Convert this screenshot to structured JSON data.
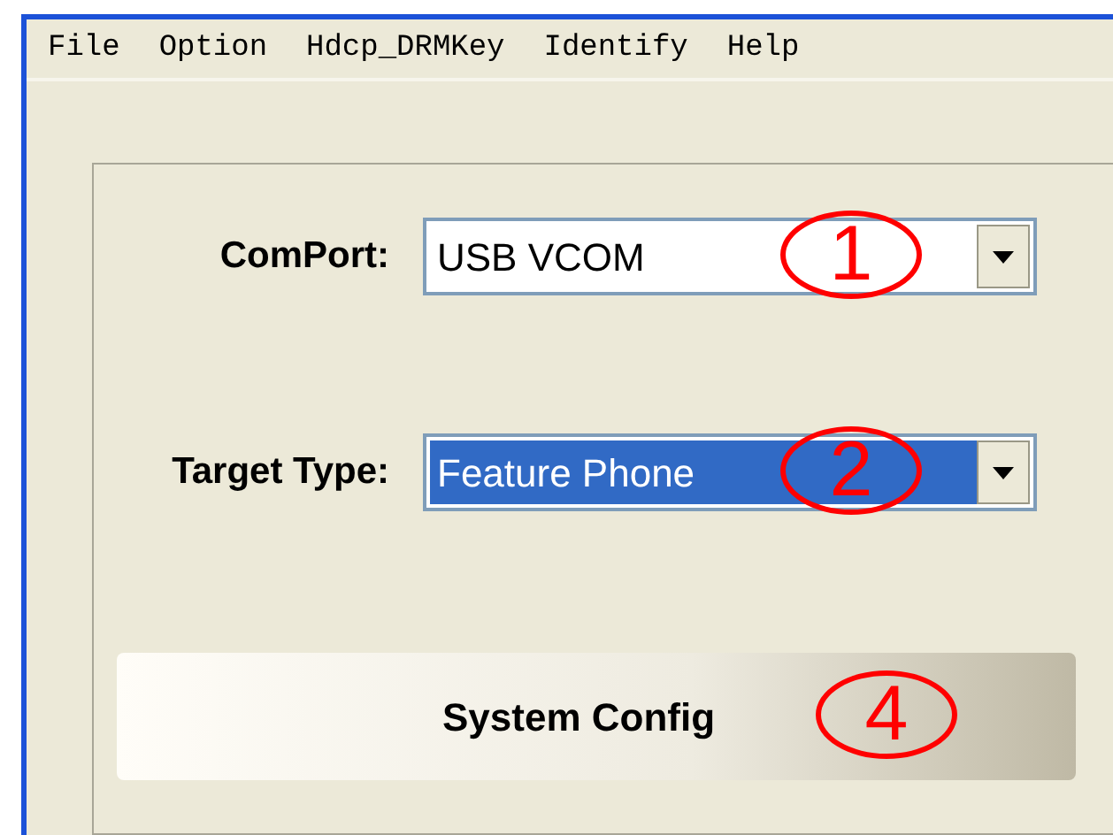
{
  "menu": [
    {
      "label": "File"
    },
    {
      "label": "Option"
    },
    {
      "label": "Hdcp_DRMKey"
    },
    {
      "label": "Identify"
    },
    {
      "label": "Help"
    }
  ],
  "fields": [
    {
      "label": "ComPort:",
      "value": "USB VCOM",
      "selected": false,
      "annotation": "1"
    },
    {
      "label": "Target Type:",
      "value": "Feature Phone",
      "selected": true,
      "annotation": "2"
    }
  ],
  "button": {
    "label": "System Config",
    "annotation": "4"
  }
}
